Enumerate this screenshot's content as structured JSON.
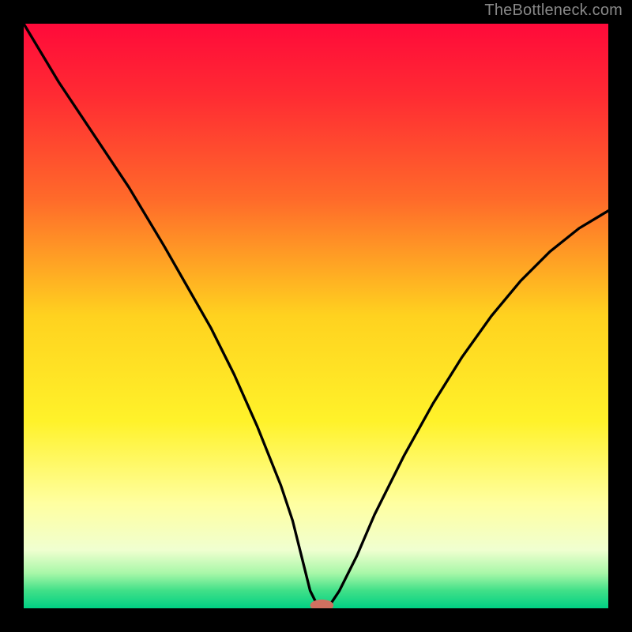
{
  "watermark": "TheBottleneck.com",
  "chart_data": {
    "type": "line",
    "title": "",
    "xlabel": "",
    "ylabel": "",
    "xlim": [
      0,
      100
    ],
    "ylim": [
      0,
      100
    ],
    "gradient_stops": [
      {
        "offset": 0.0,
        "color": "#ff0a3a"
      },
      {
        "offset": 0.12,
        "color": "#ff2a33"
      },
      {
        "offset": 0.3,
        "color": "#ff6a2a"
      },
      {
        "offset": 0.5,
        "color": "#ffd21f"
      },
      {
        "offset": 0.68,
        "color": "#fff22a"
      },
      {
        "offset": 0.82,
        "color": "#ffffa0"
      },
      {
        "offset": 0.9,
        "color": "#f0ffd0"
      },
      {
        "offset": 0.94,
        "color": "#a8f7a8"
      },
      {
        "offset": 0.97,
        "color": "#40e088"
      },
      {
        "offset": 1.0,
        "color": "#00d084"
      }
    ],
    "curve": {
      "x": [
        0,
        6,
        12,
        18,
        24,
        28,
        32,
        36,
        40,
        42,
        44,
        46,
        47,
        48,
        49,
        50,
        51,
        52,
        54,
        57,
        60,
        65,
        70,
        75,
        80,
        85,
        90,
        95,
        100
      ],
      "y": [
        100,
        90,
        81,
        72,
        62,
        55,
        48,
        40,
        31,
        26,
        21,
        15,
        11,
        7,
        3,
        1,
        0,
        0,
        3,
        9,
        16,
        26,
        35,
        43,
        50,
        56,
        61,
        65,
        68
      ]
    },
    "marker": {
      "x": 51,
      "y": 0.5,
      "rx": 2.0,
      "ry": 1.0,
      "color": "#d07060"
    }
  }
}
